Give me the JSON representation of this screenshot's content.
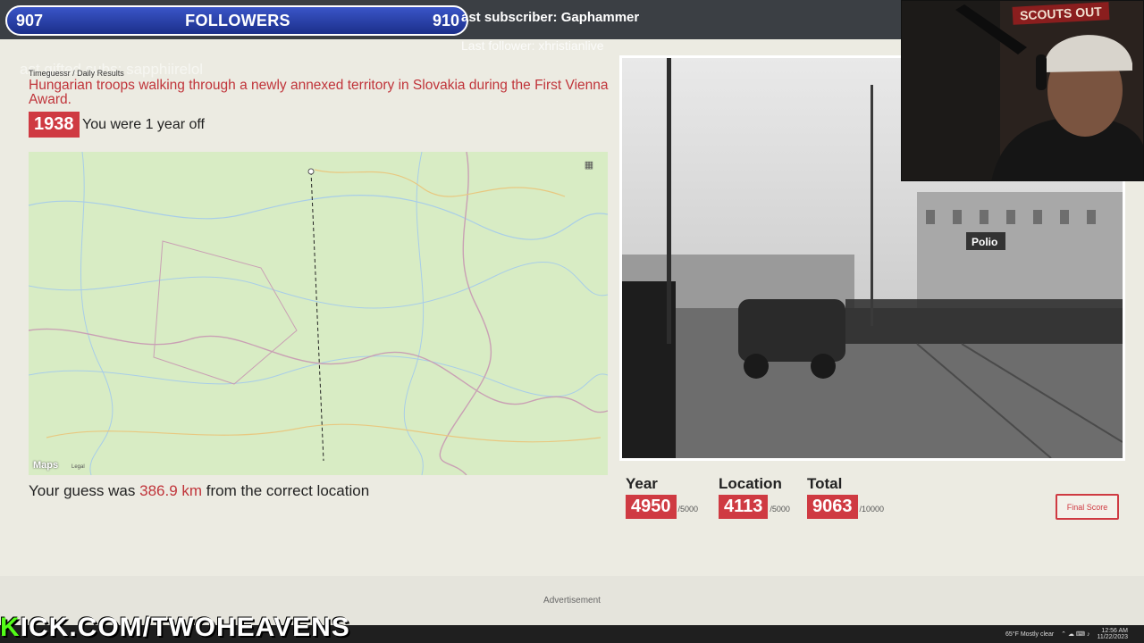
{
  "overlay": {
    "followers_left": "907",
    "followers_label": "FOLLOWERS",
    "followers_right": "910",
    "last_subscriber": "ast subscriber: Gaphammer",
    "last_follower": "Last follower: xhristianlive",
    "ghost_text": "ast gifted subs: sapphiirelol",
    "kick_prefix": "K",
    "kick_rest": "ICK.COM/TWOHEAVENS",
    "cam_sign": "SCOUTS OUT"
  },
  "game": {
    "breadcrumb": "Timeguessr / Daily Results",
    "caption": "Hungarian troops walking through a newly annexed territory in Slovakia during the First Vienna Award.",
    "year": "1938",
    "year_feedback": "You were 1 year off",
    "map_logo": "Maps",
    "map_legal": "Legal",
    "guess_prefix": "Your guess was",
    "guess_distance": "386.9 km",
    "guess_suffix": "from the correct location",
    "photo_sign": "Polio",
    "scores": {
      "year": {
        "title": "Year",
        "value": "4950",
        "max": "/5000"
      },
      "location": {
        "title": "Location",
        "value": "4113",
        "max": "/5000"
      },
      "total": {
        "title": "Total",
        "value": "9063",
        "max": "/10000"
      }
    },
    "final_button": "Final Score",
    "advertisement": "Advertisement"
  },
  "taskbar": {
    "weather": "65°F  Mostly clear",
    "time": "12:56 AM",
    "date": "11/22/2023"
  },
  "colors": {
    "accent_red": "#cf3a42",
    "map_land": "#d8ecc4",
    "kick_green": "#53fc18"
  }
}
